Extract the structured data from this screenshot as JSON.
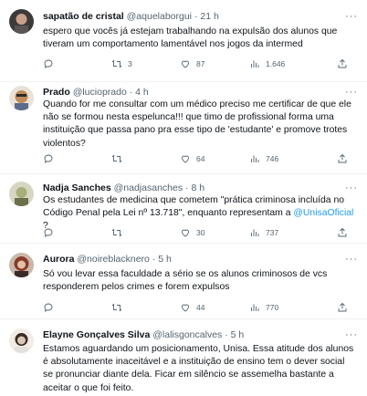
{
  "tweets": [
    {
      "name": "sapatão de cristal",
      "handle": "@aquelaborgui",
      "time": "21 h",
      "text": "espero que vocês já estejam trabalhando na expulsão dos alunos que tiveram um comportamento lamentável nos jogos da intermed",
      "retweets": "3",
      "likes": "87",
      "views": "1.646",
      "avatar_color": "#3d3a3a"
    },
    {
      "name": "Prado",
      "handle": "@lucioprado",
      "time": "4 h",
      "text": "Quando for me consultar com um médico preciso me certificar de que ele não se formou nesta espelunca!!! que timo de profissional forma uma instituição que passa pano pra esse tipo de 'estudante' e promove trotes violentos?",
      "retweets": "",
      "likes": "64",
      "views": "746",
      "avatar_color": "#c08a5a"
    },
    {
      "name": "Nadja Sanches",
      "handle": "@nadjasanches",
      "time": "8 h",
      "text": "Os estudantes de medicina que cometem \"prática criminosa incluída no Código Penal pela Lei nº 13.718\", enquanto representam a ",
      "mention": "@UnisaOficial",
      "text_end": " ?",
      "retweets": "",
      "likes": "30",
      "views": "737",
      "avatar_color": "#a8b07a"
    },
    {
      "name": "Aurora",
      "handle": "@noireblacknero",
      "time": "5 h",
      "text": "Só vou levar essa faculdade a sério se os alunos criminosos de vcs responderem pelos crimes e forem expulsos",
      "retweets": "",
      "likes": "44",
      "views": "770",
      "avatar_color": "#8a3a2a"
    },
    {
      "name": "Elayne Gonçalves Silva",
      "handle": "@lalisgoncalves",
      "time": "5 h",
      "text": "Estamos aguardando um posicionamento, Unisa. Essa atitude dos alunos é absolutamente inaceitável e a instituição de ensino tem o dever social se pronunciar diante dela. Ficar em silêncio se assemelha bastante a aceitar o que foi feito.",
      "avatar_color": "#d9c7b8"
    }
  ],
  "icons": {
    "reply": "reply-icon",
    "retweet": "retweet-icon",
    "like": "heart-icon",
    "views": "views-icon",
    "share": "share-icon",
    "more": "more-icon"
  },
  "more_label": "···",
  "dot": "·"
}
